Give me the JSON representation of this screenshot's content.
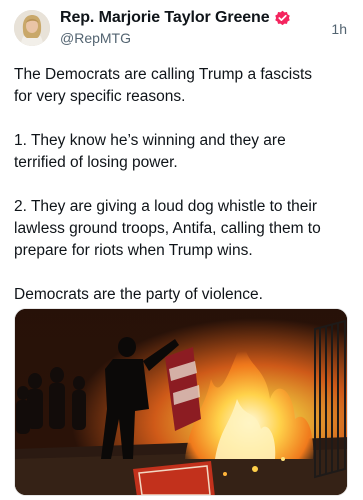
{
  "author": {
    "display_name": "Rep. Marjorie Taylor Greene",
    "handle": "@RepMTG",
    "verified_badge_color": "#f4245e"
  },
  "post": {
    "time_ago": "1h",
    "paragraphs": [
      "The Democrats are calling Trump a fascists\nfor very specific reasons.",
      "1. They know he’s winning and they are\nterrified of losing power.",
      "2. They are giving a loud dog whistle to their\nlawless ground troops, Antifa, calling them to\nprepare for riots when Trump wins.",
      "Democrats are the party of violence."
    ],
    "media": {
      "icon": "photo-fire-scene"
    }
  },
  "colors": {
    "text": "#0f1419",
    "secondary_text": "#536471"
  }
}
